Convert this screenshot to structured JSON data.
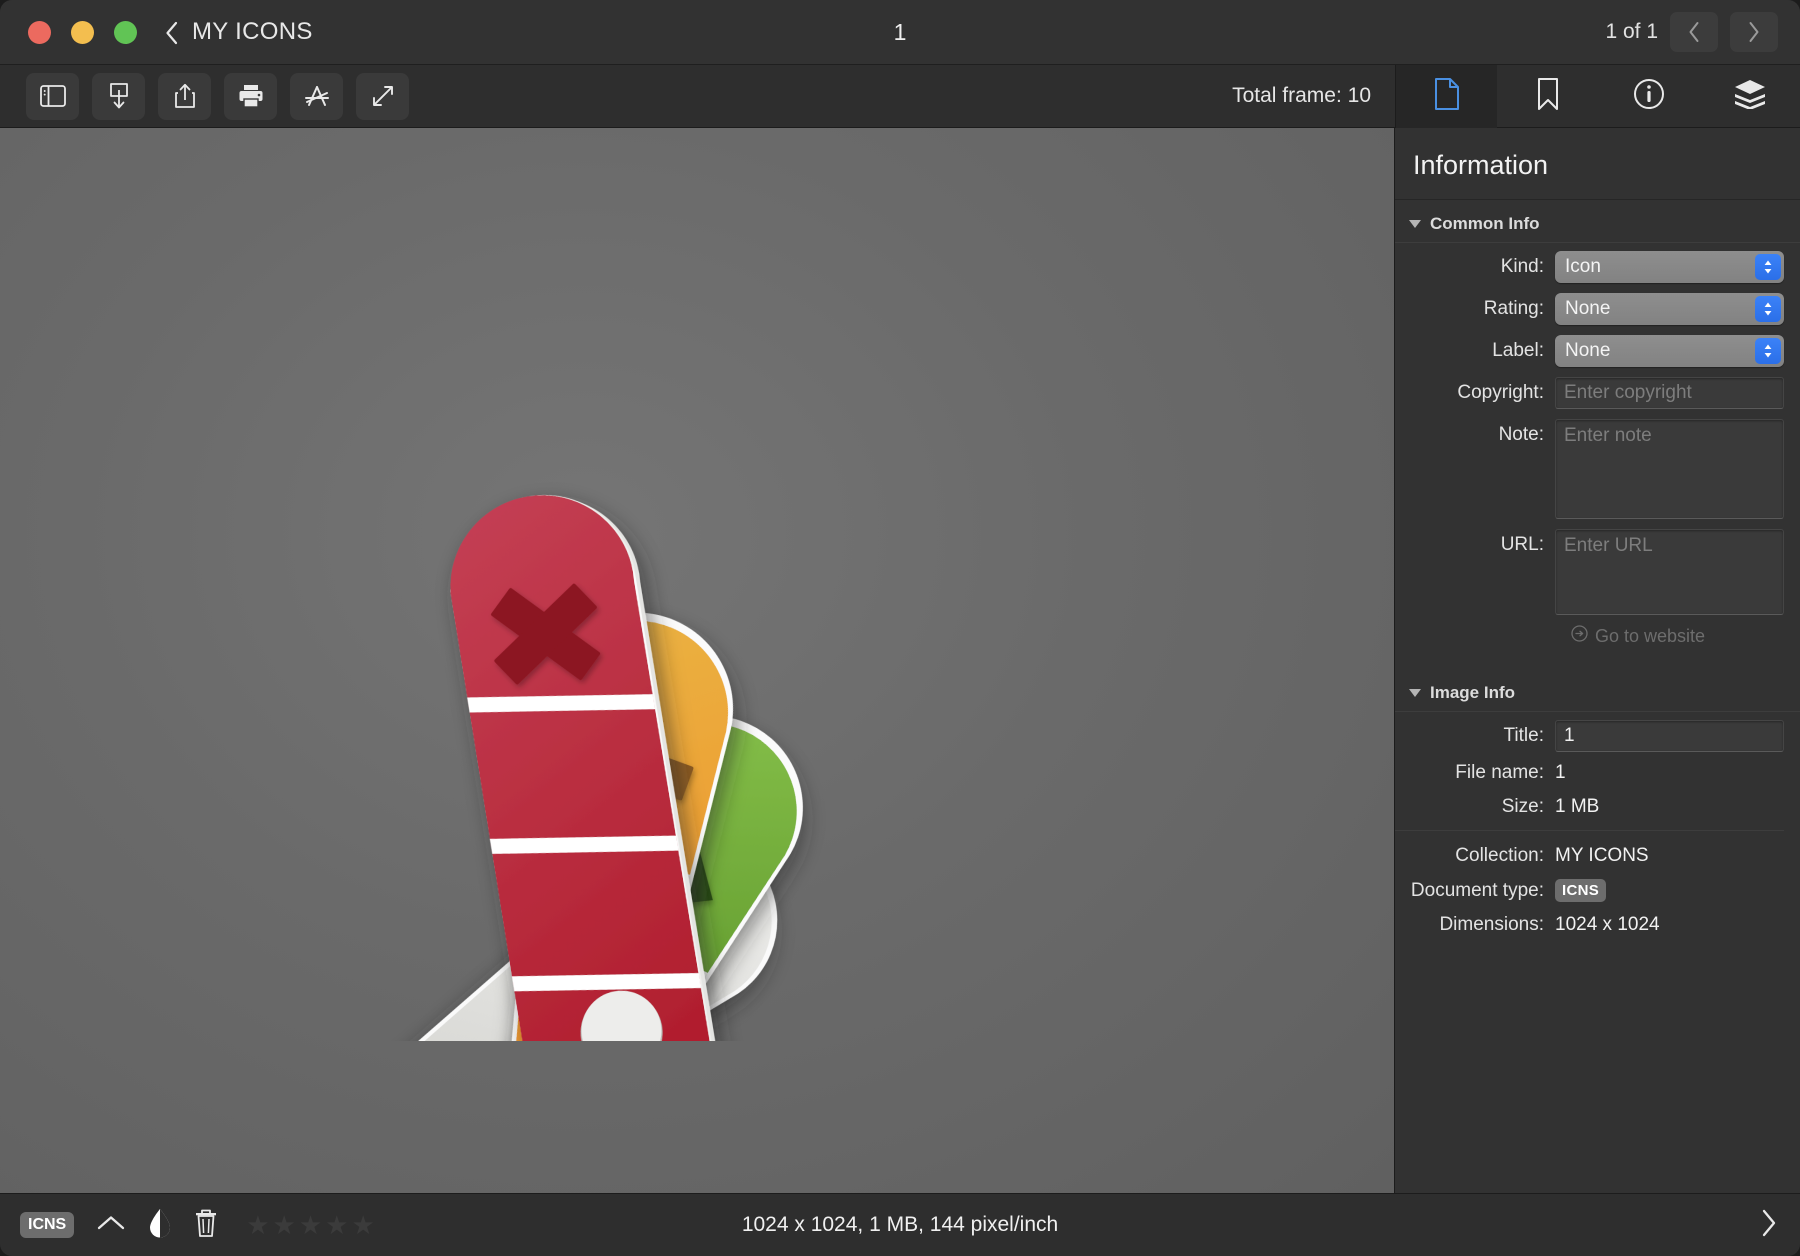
{
  "titlebar": {
    "back_icon": "chevron-left-icon",
    "collection_name": "MY ICONS",
    "document_title": "1",
    "page_count": "1 of 1",
    "prev_icon": "chevron-left-icon",
    "next_icon": "chevron-right-icon"
  },
  "toolbar": {
    "buttons": [
      {
        "name": "sidebar-toggle",
        "icon": "sidebar-icon"
      },
      {
        "name": "import-button",
        "icon": "download-icon"
      },
      {
        "name": "share-button",
        "icon": "share-icon"
      },
      {
        "name": "print-button",
        "icon": "printer-icon"
      },
      {
        "name": "app-store-button",
        "icon": "app-store-icon"
      },
      {
        "name": "fullscreen-button",
        "icon": "expand-diagonal-icon"
      }
    ],
    "total_frame_label": "Total frame: 10",
    "tabs": [
      {
        "name": "tab-document",
        "icon": "document-icon",
        "active": true
      },
      {
        "name": "tab-bookmark",
        "icon": "bookmark-icon",
        "active": false
      },
      {
        "name": "tab-info",
        "icon": "info-circle-icon",
        "active": false
      },
      {
        "name": "tab-layers",
        "icon": "layers-icon",
        "active": false
      }
    ],
    "accent_color": "#4a90e2"
  },
  "sidebar": {
    "title": "Information",
    "common_info": {
      "section_label": "Common Info",
      "kind_label": "Kind:",
      "kind_value": "Icon",
      "rating_label": "Rating:",
      "rating_value": "None",
      "label_label": "Label:",
      "label_value": "None",
      "copyright_label": "Copyright:",
      "copyright_placeholder": "Enter copyright",
      "note_label": "Note:",
      "note_placeholder": "Enter note",
      "url_label": "URL:",
      "url_placeholder": "Enter URL",
      "go_to_website": "Go to website"
    },
    "image_info": {
      "section_label": "Image Info",
      "title_label": "Title:",
      "title_value": "1",
      "file_name_label": "File name:",
      "file_name_value": "1",
      "size_label": "Size:",
      "size_value": "1 MB",
      "collection_label": "Collection:",
      "collection_value": "MY ICONS",
      "document_type_label": "Document type:",
      "document_type_value": "ICNS",
      "dimensions_label": "Dimensions:",
      "dimensions_value": "1024 x 1024"
    }
  },
  "statusbar": {
    "format_badge": "ICNS",
    "chevron_up_icon": "chevron-up-icon",
    "contrast_icon": "droplet-contrast-icon",
    "trash_icon": "trash-icon",
    "rating_stars": 5,
    "rating_filled": 0,
    "info_text": "1024 x 1024, 1 MB, 144 pixel/inch",
    "expand_icon": "chevron-right-icon"
  },
  "artwork": {
    "name": "color-fan-deck-icon",
    "swatches": [
      {
        "name": "red-swatch",
        "color": "#c0283c",
        "mark": "x-mark",
        "mark_color": "#8c1620"
      },
      {
        "name": "orange-swatch",
        "color": "#e8a33a",
        "mark": "minus-mark",
        "mark_color": "#8a5a22"
      },
      {
        "name": "green-swatch",
        "color": "#7cb342",
        "mark": "triangles-mark",
        "mark_color": "#2b4d16"
      },
      {
        "name": "white-swatch",
        "color": "#e6e6e4",
        "mark": "none",
        "mark_color": ""
      }
    ],
    "background_color": "#6a6a6a"
  }
}
